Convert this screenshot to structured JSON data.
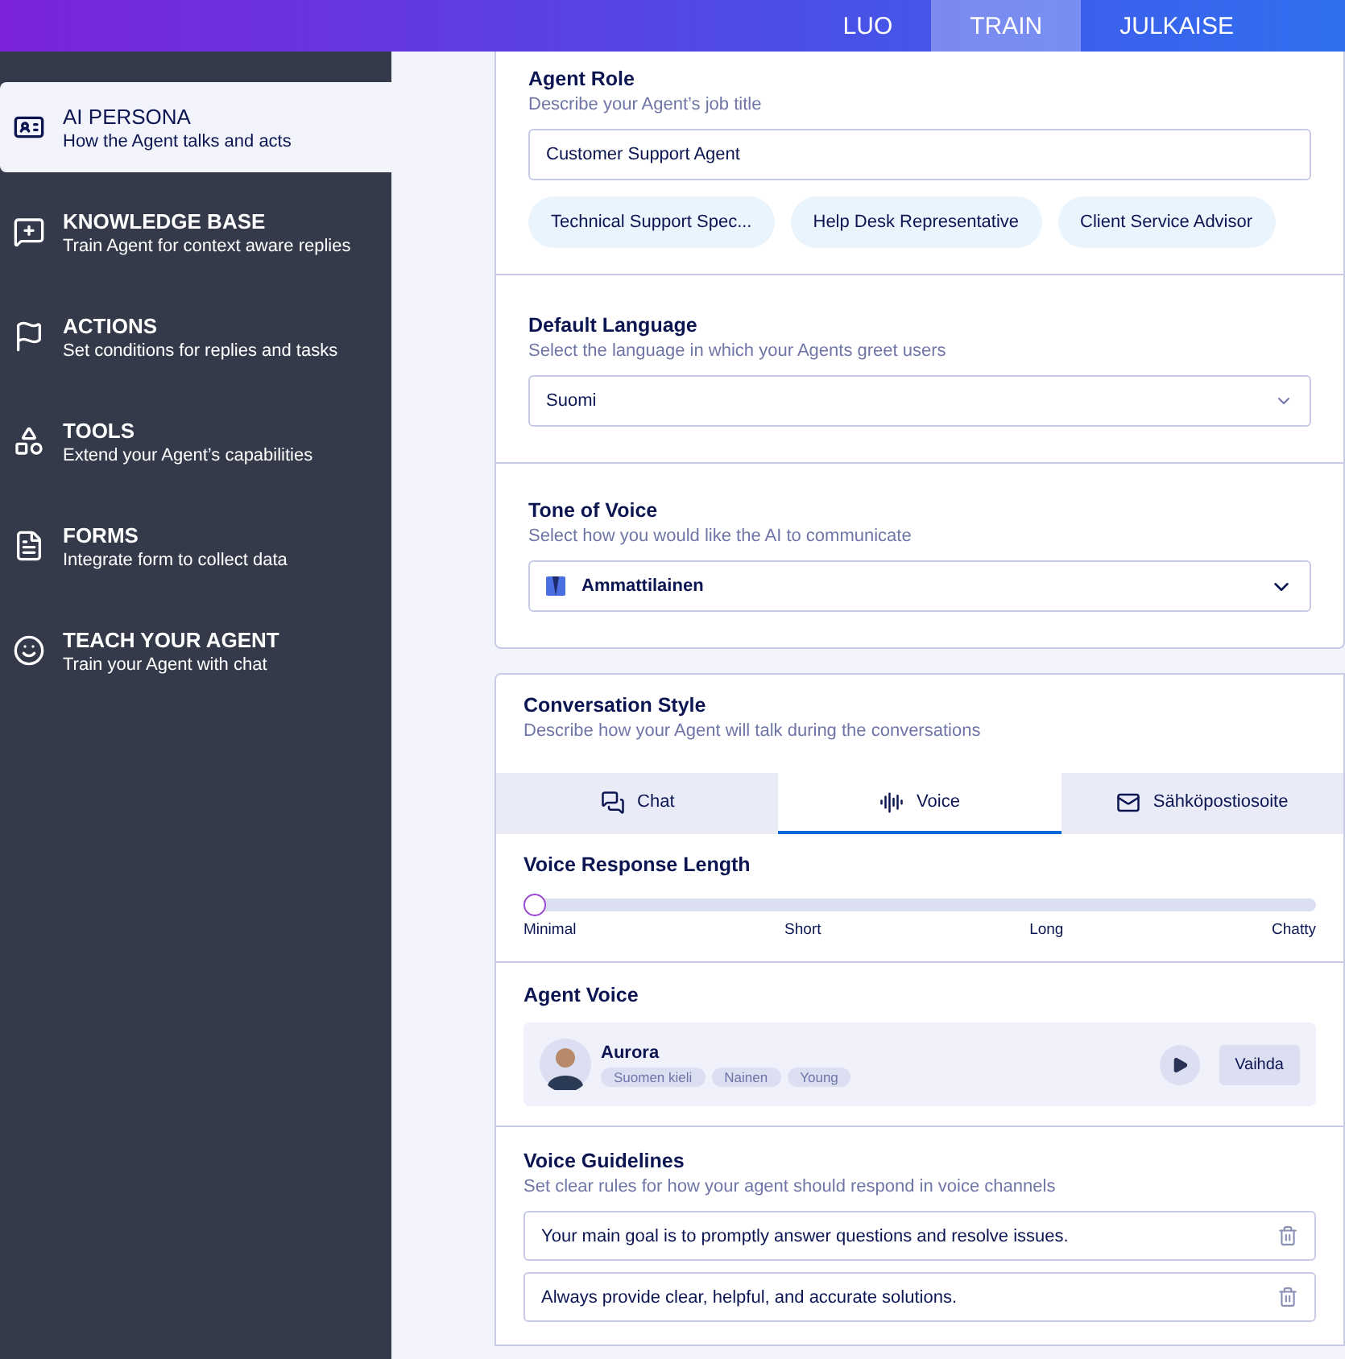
{
  "top_tabs": [
    {
      "label": "LUO",
      "selected": false
    },
    {
      "label": "TRAIN",
      "selected": true
    },
    {
      "label": "JULKAISE",
      "selected": false
    }
  ],
  "sidebar": {
    "items": [
      {
        "title": "AI PERSONA",
        "subtitle": "How the Agent talks and acts",
        "selected": true
      },
      {
        "title": "KNOWLEDGE BASE",
        "subtitle": "Train Agent for context aware replies",
        "selected": false
      },
      {
        "title": "ACTIONS",
        "subtitle": "Set conditions for replies and tasks",
        "selected": false
      },
      {
        "title": "TOOLS",
        "subtitle": "Extend your Agent’s capabilities",
        "selected": false
      },
      {
        "title": "FORMS",
        "subtitle": "Integrate form to collect data",
        "selected": false
      },
      {
        "title": "TEACH YOUR AGENT",
        "subtitle": "Train your Agent with chat",
        "selected": false
      }
    ]
  },
  "agent_role": {
    "title": "Agent Role",
    "description": "Describe your Agent’s job title",
    "value": "Customer Support Agent",
    "suggestions": [
      "Technical Support Spec...",
      "Help Desk Representative",
      "Client Service Advisor"
    ]
  },
  "default_language": {
    "title": "Default Language",
    "description": "Select the language in which your Agents greet users",
    "value": "Suomi"
  },
  "tone_of_voice": {
    "title": "Tone of Voice",
    "description": "Select how you would like the AI to communicate",
    "value": "Ammattilainen"
  },
  "conversation_style": {
    "title": "Conversation Style",
    "description": "Describe how your Agent will talk during the conversations",
    "tabs": [
      {
        "label": "Chat",
        "selected": false
      },
      {
        "label": "Voice",
        "selected": true
      },
      {
        "label": "Sähköpostiosoite",
        "selected": false
      }
    ],
    "response_length": {
      "title": "Voice Response Length",
      "level": 0,
      "labels": [
        "Minimal",
        "Short",
        "Long",
        "Chatty"
      ]
    },
    "agent_voice": {
      "title": "Agent Voice",
      "name": "Aurora",
      "tags": [
        "Suomen kieli",
        "Nainen",
        "Young"
      ],
      "change_button": "Vaihda"
    },
    "guidelines": {
      "title": "Voice Guidelines",
      "description": "Set clear rules for how your agent should respond in voice channels",
      "items": [
        "Your main goal is to promptly answer questions and resolve issues.",
        "Always provide clear, helpful, and accurate solutions."
      ]
    }
  }
}
